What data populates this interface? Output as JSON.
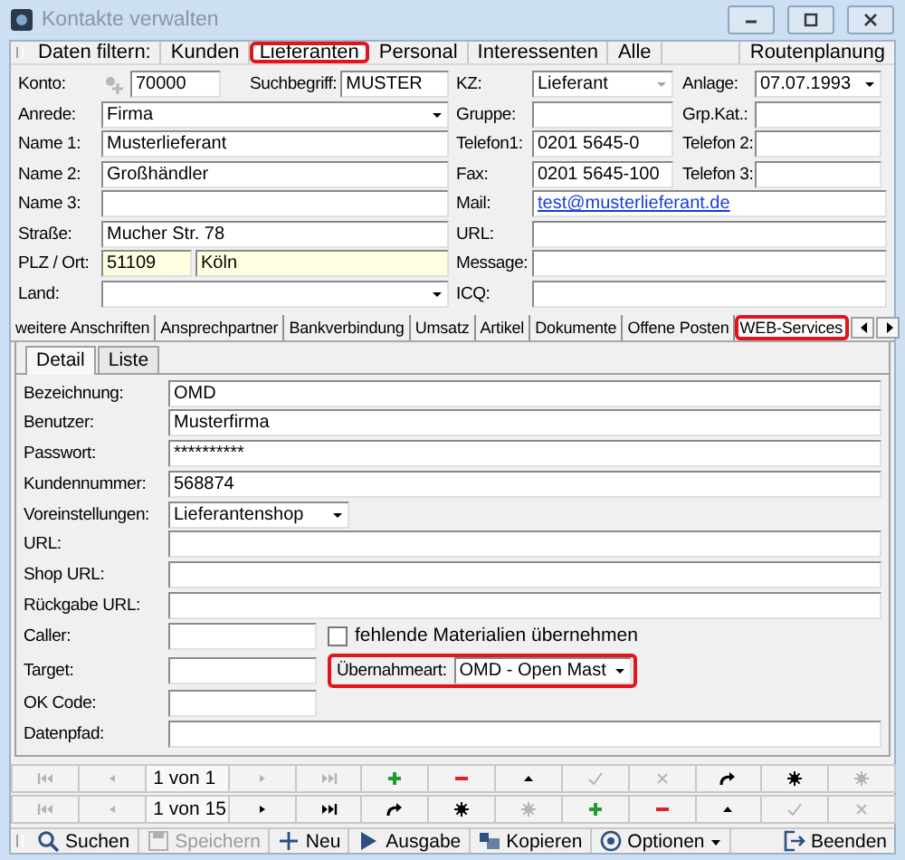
{
  "window": {
    "title": "Kontakte verwalten"
  },
  "filter_bar": {
    "label": "Daten filtern:",
    "filters": [
      {
        "label": "Kunden",
        "selected": false,
        "highlighted": false
      },
      {
        "label": "Lieferanten",
        "selected": true,
        "highlighted": true
      },
      {
        "label": "Personal",
        "selected": false,
        "highlighted": false
      },
      {
        "label": "Interessenten",
        "selected": false,
        "highlighted": false
      },
      {
        "label": "Alle",
        "selected": false,
        "highlighted": false
      }
    ],
    "route_button": "Routenplanung"
  },
  "contact": {
    "left": [
      {
        "label": "Konto:",
        "kind": "konto",
        "value": "70000",
        "search_label": "Suchbegriff:",
        "search_value": "MUSTER"
      },
      {
        "label": "Anrede:",
        "kind": "dropdown",
        "value": "Firma"
      },
      {
        "label": "Name 1:",
        "kind": "text",
        "value": "Musterlieferant"
      },
      {
        "label": "Name 2:",
        "kind": "text",
        "value": "Großhändler"
      },
      {
        "label": "Name 3:",
        "kind": "text"
      },
      {
        "label": "Straße:",
        "kind": "text",
        "value": "Mucher Str. 78"
      },
      {
        "label": "PLZ / Ort:",
        "kind": "pair",
        "value": "51109",
        "value2": "Köln"
      },
      {
        "label": "Land:",
        "kind": "dropdown"
      }
    ],
    "right": [
      {
        "fields": [
          {
            "label": "KZ:",
            "kind": "dropdown",
            "value": "Lieferant",
            "disabled": true
          },
          {
            "label": "Anlage:",
            "kind": "dropdown",
            "value": "07.07.1993",
            "disabled": false
          }
        ]
      },
      {
        "fields": [
          {
            "label": "Gruppe:",
            "kind": "text"
          },
          {
            "label": "Grp.Kat.:",
            "kind": "text"
          }
        ]
      },
      {
        "fields": [
          {
            "label": "Telefon1:",
            "kind": "text",
            "value": "0201 5645-0"
          },
          {
            "label": "Telefon 2:",
            "kind": "text"
          }
        ]
      },
      {
        "fields": [
          {
            "label": "Fax:",
            "kind": "text",
            "value": "0201 5645-100"
          },
          {
            "label": "Telefon 3:",
            "kind": "text"
          }
        ]
      },
      {
        "fields": [
          {
            "label": "Mail:",
            "kind": "link",
            "value": "test@musterlieferant.de"
          }
        ]
      },
      {
        "fields": [
          {
            "label": "URL:",
            "kind": "text"
          }
        ]
      },
      {
        "fields": [
          {
            "label": "Message:",
            "kind": "text"
          }
        ]
      },
      {
        "fields": [
          {
            "label": "ICQ:",
            "kind": "text"
          }
        ]
      }
    ]
  },
  "tabs": [
    {
      "label": "weitere Anschriften",
      "selected": false,
      "highlighted": false
    },
    {
      "label": "Ansprechpartner",
      "selected": false,
      "highlighted": false
    },
    {
      "label": "Bankverbindung",
      "selected": false,
      "highlighted": false
    },
    {
      "label": "Umsatz",
      "selected": false,
      "highlighted": false
    },
    {
      "label": "Artikel",
      "selected": false,
      "highlighted": false
    },
    {
      "label": "Dokumente",
      "selected": false,
      "highlighted": false
    },
    {
      "label": "Offene Posten",
      "selected": false,
      "highlighted": false
    },
    {
      "label": "WEB-Services",
      "selected": true,
      "highlighted": true
    }
  ],
  "subtabs": [
    {
      "label": "Detail",
      "selected": true
    },
    {
      "label": "Liste",
      "selected": false
    }
  ],
  "web": {
    "fields": [
      {
        "label": "Bezeichnung:",
        "kind": "text",
        "value": "OMD"
      },
      {
        "label": "Benutzer:",
        "kind": "text",
        "value": "Musterfirma"
      },
      {
        "label": "Passwort:",
        "kind": "text",
        "value": "**********"
      },
      {
        "label": "Kundennummer:",
        "kind": "text",
        "value": "568874"
      },
      {
        "label": "Voreinstellungen:",
        "kind": "dropdown",
        "value": "Lieferantenshop"
      },
      {
        "label": "URL:",
        "kind": "text"
      },
      {
        "label": "Shop URL:",
        "kind": "text"
      },
      {
        "label": "Rückgabe URL:",
        "kind": "text"
      },
      {
        "label": "Caller:",
        "kind": "short"
      },
      {
        "label": "Target:",
        "kind": "short"
      },
      {
        "label": "OK Code:",
        "kind": "short"
      },
      {
        "label": "Datenpfad:",
        "kind": "text"
      }
    ],
    "checkbox": {
      "label": "fehlende Materialien übernehmen",
      "checked": false
    },
    "transfer": {
      "label": "Übernahmeart:",
      "value": "OMD - Open Mast",
      "highlighted": true
    }
  },
  "navigators": [
    {
      "position": "1 von 1",
      "buttons": [
        {
          "kind": "first",
          "disabled": true
        },
        {
          "kind": "prev",
          "disabled": true
        },
        {
          "kind": "next",
          "disabled": true
        },
        {
          "kind": "last",
          "disabled": true
        },
        {
          "kind": "add",
          "disabled": false
        },
        {
          "kind": "remove",
          "disabled": false
        },
        {
          "kind": "up",
          "disabled": false
        },
        {
          "kind": "confirm",
          "disabled": true
        },
        {
          "kind": "cancel",
          "disabled": true
        },
        {
          "kind": "redo",
          "disabled": false
        },
        {
          "kind": "star",
          "disabled": false
        },
        {
          "kind": "star",
          "disabled": true
        }
      ]
    },
    {
      "position": "1 von 15",
      "buttons": [
        {
          "kind": "first",
          "disabled": true
        },
        {
          "kind": "prev",
          "disabled": true
        },
        {
          "kind": "next",
          "disabled": false
        },
        {
          "kind": "last",
          "disabled": false
        },
        {
          "kind": "redo",
          "disabled": false
        },
        {
          "kind": "star",
          "disabled": false
        },
        {
          "kind": "star",
          "disabled": true
        },
        {
          "kind": "add",
          "disabled": false
        },
        {
          "kind": "remove",
          "disabled": false
        },
        {
          "kind": "up",
          "disabled": false
        },
        {
          "kind": "confirm",
          "disabled": true
        },
        {
          "kind": "cancel",
          "disabled": true
        }
      ]
    }
  ],
  "toolbar": [
    {
      "label": "Suchen",
      "kind": "search",
      "disabled": false
    },
    {
      "label": "Speichern",
      "kind": "save",
      "disabled": true
    },
    {
      "label": "Neu",
      "kind": "new",
      "disabled": false
    },
    {
      "label": "Ausgabe",
      "kind": "output",
      "disabled": false
    },
    {
      "label": "Kopieren",
      "kind": "copy",
      "disabled": false
    },
    {
      "label": "Optionen",
      "kind": "options",
      "disabled": false,
      "menu": true
    },
    {
      "label": "Beenden",
      "kind": "exit",
      "disabled": false
    }
  ]
}
